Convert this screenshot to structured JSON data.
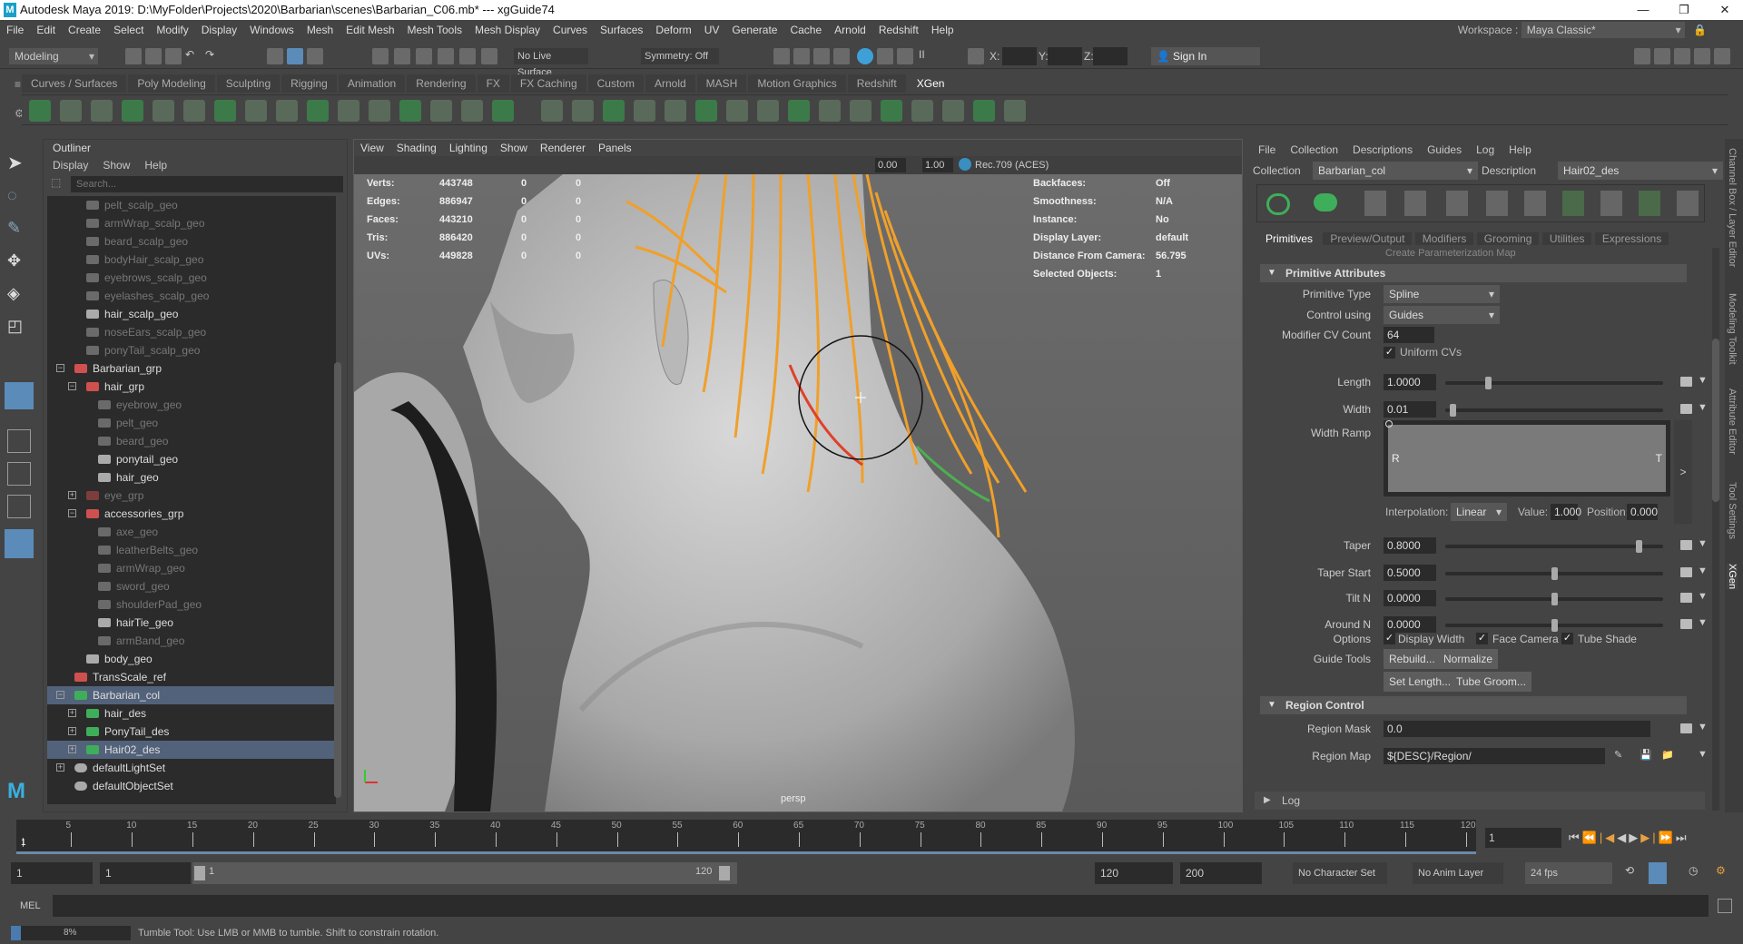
{
  "window": {
    "title": "Autodesk Maya 2019: D:\\MyFolder\\Projects\\2020\\Barbarian\\scenes\\Barbarian_C06.mb*  ---  xgGuide74",
    "logo": "M"
  },
  "menubar": [
    "File",
    "Edit",
    "Create",
    "Select",
    "Modify",
    "Display",
    "Windows",
    "Mesh",
    "Edit Mesh",
    "Mesh Tools",
    "Mesh Display",
    "Curves",
    "Surfaces",
    "Deform",
    "UV",
    "Generate",
    "Cache",
    "Arnold",
    "Redshift",
    "Help"
  ],
  "workspace": {
    "label": "Workspace :",
    "value": "Maya Classic*"
  },
  "statusline": {
    "menuset": "Modeling",
    "live_surface": "No Live Surface",
    "symmetry": "Symmetry: Off",
    "x_label": "X:",
    "y_label": "Y:",
    "z_label": "Z:",
    "sign_in": "Sign In"
  },
  "shelf": {
    "tabs": [
      "Curves / Surfaces",
      "Poly Modeling",
      "Sculpting",
      "Rigging",
      "Animation",
      "Rendering",
      "FX",
      "FX Caching",
      "Custom",
      "Arnold",
      "MASH",
      "Motion Graphics",
      "Redshift",
      "XGen"
    ],
    "active_tab": "XGen"
  },
  "outliner": {
    "title": "Outliner",
    "menu": [
      "Display",
      "Show",
      "Help"
    ],
    "search_placeholder": "Search...",
    "items": [
      {
        "name": "pelt_scalp_geo",
        "level": 1,
        "type": "mesh",
        "dim": true
      },
      {
        "name": "armWrap_scalp_geo",
        "level": 1,
        "type": "mesh",
        "dim": true
      },
      {
        "name": "beard_scalp_geo",
        "level": 1,
        "type": "mesh",
        "dim": true
      },
      {
        "name": "bodyHair_scalp_geo",
        "level": 1,
        "type": "mesh",
        "dim": true
      },
      {
        "name": "eyebrows_scalp_geo",
        "level": 1,
        "type": "mesh",
        "dim": true
      },
      {
        "name": "eyelashes_scalp_geo",
        "level": 1,
        "type": "mesh",
        "dim": true
      },
      {
        "name": "hair_scalp_geo",
        "level": 1,
        "type": "mesh",
        "dim": false
      },
      {
        "name": "noseEars_scalp_geo",
        "level": 1,
        "type": "mesh",
        "dim": true
      },
      {
        "name": "ponyTail_scalp_geo",
        "level": 1,
        "type": "mesh",
        "dim": true
      },
      {
        "name": "Barbarian_grp",
        "level": 0,
        "type": "group",
        "dim": false,
        "expand": "-"
      },
      {
        "name": "hair_grp",
        "level": 1,
        "type": "group",
        "dim": false,
        "expand": "-"
      },
      {
        "name": "eyebrow_geo",
        "level": 2,
        "type": "mesh",
        "dim": true
      },
      {
        "name": "pelt_geo",
        "level": 2,
        "type": "mesh",
        "dim": true
      },
      {
        "name": "beard_geo",
        "level": 2,
        "type": "mesh",
        "dim": true
      },
      {
        "name": "ponytail_geo",
        "level": 2,
        "type": "mesh",
        "dim": false
      },
      {
        "name": "hair_geo",
        "level": 2,
        "type": "mesh",
        "dim": false
      },
      {
        "name": "eye_grp",
        "level": 1,
        "type": "group",
        "dim": true,
        "expand": "+"
      },
      {
        "name": "accessories_grp",
        "level": 1,
        "type": "group",
        "dim": false,
        "expand": "-"
      },
      {
        "name": "axe_geo",
        "level": 2,
        "type": "mesh",
        "dim": true
      },
      {
        "name": "leatherBelts_geo",
        "level": 2,
        "type": "mesh",
        "dim": true
      },
      {
        "name": "armWrap_geo",
        "level": 2,
        "type": "mesh",
        "dim": true
      },
      {
        "name": "sword_geo",
        "level": 2,
        "type": "mesh",
        "dim": true
      },
      {
        "name": "shoulderPad_geo",
        "level": 2,
        "type": "mesh",
        "dim": true
      },
      {
        "name": "hairTie_geo",
        "level": 2,
        "type": "mesh",
        "dim": false
      },
      {
        "name": "armBand_geo",
        "level": 2,
        "type": "mesh",
        "dim": true
      },
      {
        "name": "body_geo",
        "level": 1,
        "type": "mesh",
        "dim": false
      },
      {
        "name": "TransScale_ref",
        "level": 0,
        "type": "group",
        "dim": false
      },
      {
        "name": "Barbarian_col",
        "level": 0,
        "type": "xgen-collection",
        "dim": false,
        "expand": "-",
        "selected": true
      },
      {
        "name": "hair_des",
        "level": 1,
        "type": "xgen-description",
        "dim": false,
        "expand": "+"
      },
      {
        "name": "PonyTail_des",
        "level": 1,
        "type": "xgen-description",
        "dim": false,
        "expand": "+"
      },
      {
        "name": "Hair02_des",
        "level": 1,
        "type": "xgen-description",
        "dim": false,
        "expand": "+",
        "selected": true
      },
      {
        "name": "defaultLightSet",
        "level": 0,
        "type": "set",
        "dim": false,
        "expand": "+"
      },
      {
        "name": "defaultObjectSet",
        "level": 0,
        "type": "set",
        "dim": false
      }
    ]
  },
  "viewport": {
    "menu": [
      "View",
      "Shading",
      "Lighting",
      "Show",
      "Renderer",
      "Panels"
    ],
    "exposure": "0.00",
    "gamma": "1.00",
    "color_space": "Rec.709 (ACES)",
    "camera": "persp",
    "hud_left": [
      {
        "label": "Verts:",
        "v1": "443748",
        "v2": "0",
        "v3": "0"
      },
      {
        "label": "Edges:",
        "v1": "886947",
        "v2": "0",
        "v3": "0"
      },
      {
        "label": "Faces:",
        "v1": "443210",
        "v2": "0",
        "v3": "0"
      },
      {
        "label": "Tris:",
        "v1": "886420",
        "v2": "0",
        "v3": "0"
      },
      {
        "label": "UVs:",
        "v1": "449828",
        "v2": "0",
        "v3": "0"
      }
    ],
    "hud_right": [
      {
        "label": "Backfaces:",
        "value": "Off"
      },
      {
        "label": "Smoothness:",
        "value": "N/A"
      },
      {
        "label": "Instance:",
        "value": "No"
      },
      {
        "label": "Display Layer:",
        "value": "default"
      },
      {
        "label": "Distance From Camera:",
        "value": "56.795"
      },
      {
        "label": "Selected Objects:",
        "value": "1"
      }
    ],
    "colors": {
      "guides": "#f0a02a",
      "selected_guide": "#e0402a"
    }
  },
  "xgen": {
    "menu": [
      "File",
      "Collection",
      "Descriptions",
      "Guides",
      "Log",
      "Help"
    ],
    "collection_label": "Collection",
    "collection": "Barbarian_col",
    "description_label": "Description",
    "description": "Hair02_des",
    "tabs": [
      "Primitives",
      "Preview/Output",
      "Modifiers",
      "Grooming",
      "Utilities",
      "Expressions"
    ],
    "active_tab": "Primitives",
    "cut_text": "Create Parameterization Map",
    "primitive_attributes": {
      "header": "Primitive Attributes",
      "primitive_type_label": "Primitive Type",
      "primitive_type": "Spline",
      "control_using_label": "Control using",
      "control_using": "Guides",
      "cv_count_label": "Modifier CV Count",
      "cv_count": "64",
      "uniform_cvs": "Uniform CVs",
      "uniform_cvs_checked": true,
      "sliders": [
        {
          "label": "Length",
          "value": "1.0000",
          "position": 0.19
        },
        {
          "label": "Width",
          "value": "0.01",
          "position": 0.02
        },
        {
          "label": "Taper",
          "value": "0.8000",
          "position": 0.9
        },
        {
          "label": "Taper Start",
          "value": "0.5000",
          "position": 0.5
        },
        {
          "label": "Tilt N",
          "value": "0.0000",
          "position": 0.5
        },
        {
          "label": "Around N",
          "value": "0.0000",
          "position": 0.5
        }
      ],
      "width_ramp_label": "Width Ramp",
      "ramp_left": "R",
      "ramp_right": "T",
      "ramp_expand": ">",
      "interpolation_label": "Interpolation:",
      "interpolation": "Linear",
      "value_label": "Value:",
      "value": "1.000",
      "position_label": "Position:",
      "position": "0.000",
      "options_label": "Options",
      "options": [
        {
          "label": "Display Width",
          "checked": true
        },
        {
          "label": "Face Camera",
          "checked": true
        },
        {
          "label": "Tube Shade",
          "checked": true
        }
      ],
      "guide_tools_label": "Guide Tools",
      "guide_tools": [
        "Rebuild...",
        "Normalize",
        "Set Length...",
        "Tube Groom..."
      ]
    },
    "region_control": {
      "header": "Region Control",
      "mask_label": "Region Mask",
      "mask": "0.0",
      "map_label": "Region Map",
      "map": "${DESC}/Region/"
    },
    "log": "Log"
  },
  "right_tabs": [
    "Channel Box / Layer Editor",
    "Modeling Toolkit",
    "Attribute Editor",
    "Tool Settings",
    "XGen"
  ],
  "timeline": {
    "start": 1,
    "end": 120,
    "labels": [
      5,
      10,
      15,
      20,
      25,
      30,
      35,
      40,
      45,
      50,
      55,
      60,
      65,
      70,
      75,
      80,
      85,
      90,
      95,
      100,
      105,
      110,
      115,
      120
    ],
    "current_frame": "1",
    "current_marker": "1"
  },
  "range": {
    "start": "1",
    "playback_start": "1",
    "slider_start": "1",
    "slider_end": "120",
    "playback_end": "120",
    "end": "200",
    "character_set": "No Character Set",
    "anim_layer": "No Anim Layer",
    "fps": "24 fps"
  },
  "mel": {
    "label": "MEL"
  },
  "help": {
    "progress": "8%",
    "progress_value": 8,
    "message": "Tumble Tool: Use LMB or MMB to tumble. Shift to constrain rotation."
  }
}
